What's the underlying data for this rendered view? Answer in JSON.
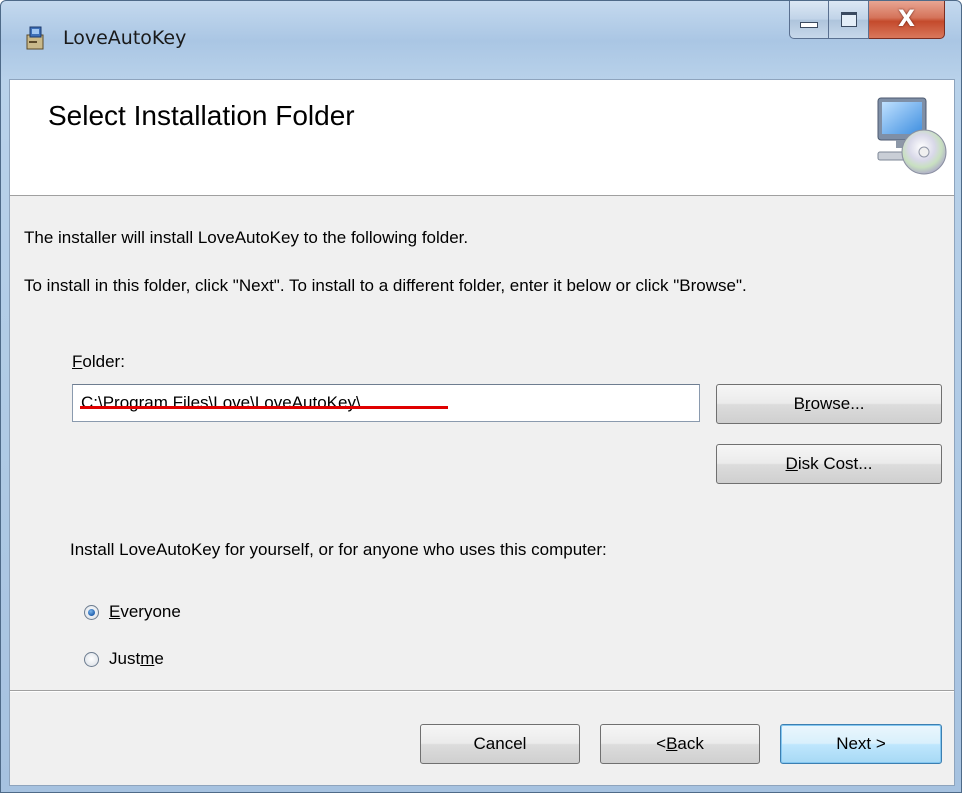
{
  "window": {
    "title": "LoveAutoKey",
    "minimize_label": "minimize",
    "maximize_label": "maximize",
    "close_glyph": "X"
  },
  "header": {
    "title": "Select Installation Folder"
  },
  "body": {
    "intro": "The installer will install LoveAutoKey to the following folder.",
    "instructions": "To install in this folder, click \"Next\". To install to a different folder, enter it below or click \"Browse\".",
    "folder_label_accel": "F",
    "folder_label_rest": "older:",
    "folder_value": "C:\\Program Files\\Love\\LoveAutoKey\\",
    "browse_pre": "B",
    "browse_accel": "r",
    "browse_post": "owse...",
    "diskcost_accel": "D",
    "diskcost_post": "isk Cost...",
    "install_for": "Install LoveAutoKey for yourself, or for anyone who uses this computer:",
    "everyone_accel": "E",
    "everyone_post": "veryone",
    "justme_pre": "Just ",
    "justme_accel": "m",
    "justme_post": "e",
    "selected_option": "Everyone"
  },
  "footer": {
    "cancel": "Cancel",
    "back_pre": "< ",
    "back_accel": "B",
    "back_post": "ack",
    "next": "Next >"
  },
  "icons": {
    "app": "installer-app-icon",
    "header": "computer-cd-icon"
  },
  "colors": {
    "frame": "#aac6e4",
    "close": "#c44a2c",
    "default_button": "#3c7fb1",
    "radio_dot": "#1f5fae"
  }
}
